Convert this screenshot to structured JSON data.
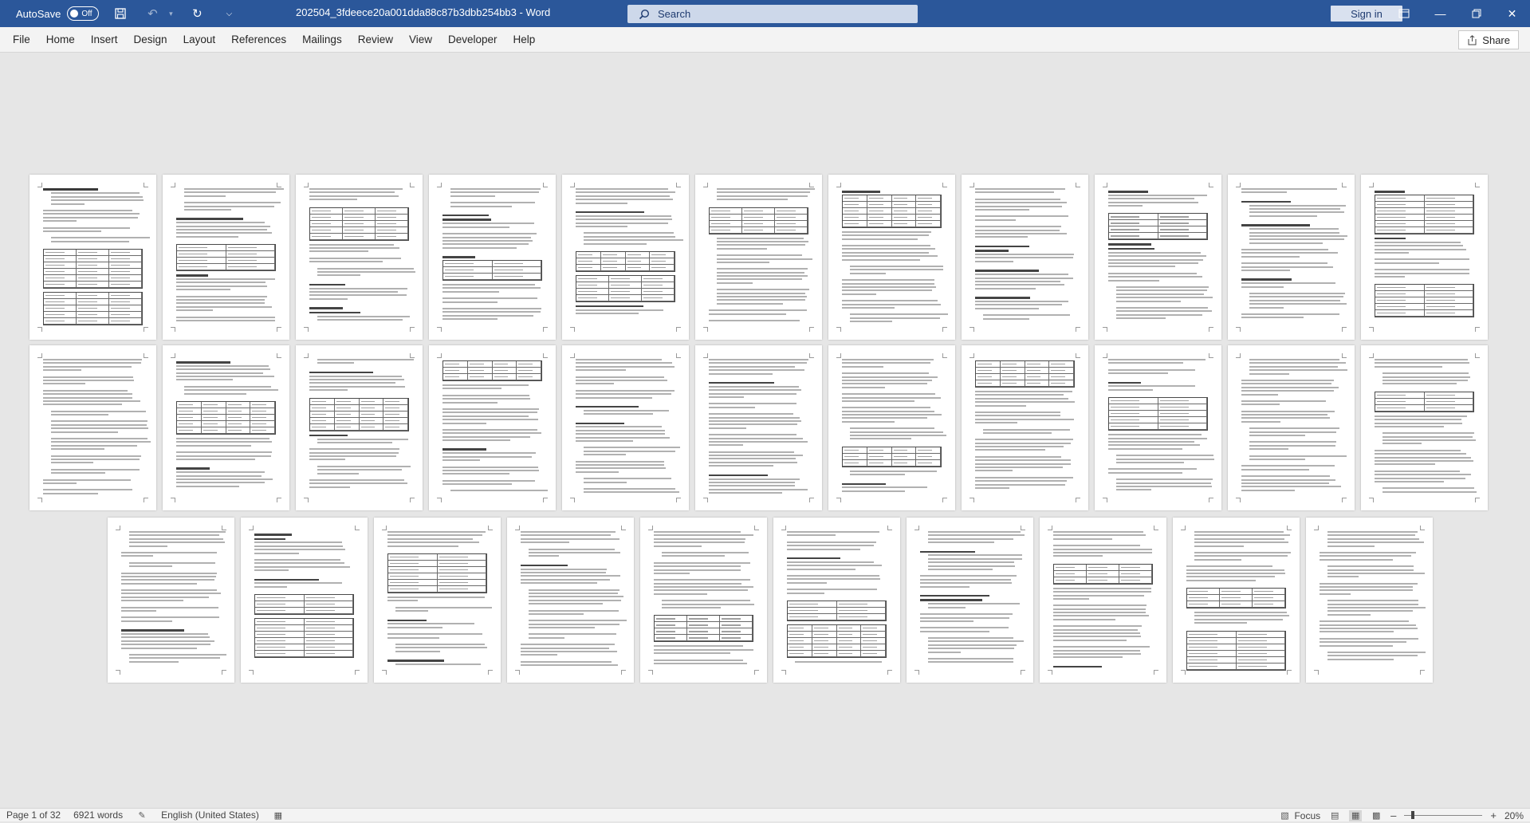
{
  "titlebar": {
    "autosave_label": "AutoSave",
    "autosave_state": "Off",
    "doc_title": "202504_3fdeece20a001dda88c87b3dbb254bb3  -  Word",
    "search_placeholder": "Search",
    "signin_label": "Sign in"
  },
  "ribbon": {
    "tabs": [
      "File",
      "Home",
      "Insert",
      "Design",
      "Layout",
      "References",
      "Mailings",
      "Review",
      "View",
      "Developer",
      "Help"
    ],
    "share_label": "Share"
  },
  "status": {
    "page": "Page 1 of 32",
    "words": "6921 words",
    "language": "English (United States)",
    "focus": "Focus",
    "zoom": "20%",
    "zoom_level_percent": 20
  },
  "colors": {
    "title_bar": "#2b579a",
    "ribbon_bg": "#f3f3f3",
    "canvas_bg": "#e6e6e6"
  }
}
